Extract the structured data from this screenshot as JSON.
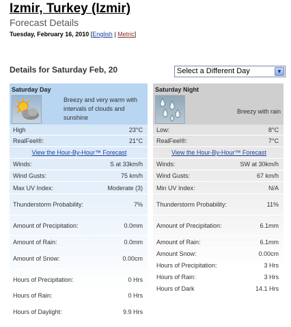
{
  "header": {
    "title": "Izmir, Turkey (Izmir)",
    "subtitle": "Forecast Details",
    "date": "Tuesday, February 16, 2010",
    "bracket_open": "[",
    "link_english": "English",
    "separator": "|",
    "link_metric": "Metric",
    "bracket_close": "]"
  },
  "details": {
    "heading": "Details for Saturday Feb, 20",
    "select_value": "Select a Different Day"
  },
  "day": {
    "title": "Saturday Day",
    "icon": "partly-sunny-icon",
    "description": "Breezy and very warm with intervals of clouds and sunshine",
    "rows": [
      {
        "label": "High",
        "value": "23°C"
      },
      {
        "label": "RealFeel®:",
        "value": "21°C"
      },
      {
        "link": "View the Hour-By-Hour™ Forecast"
      },
      {
        "label": "Winds:",
        "value": "S at 33km/h"
      },
      {
        "label": "Wind Gusts:",
        "value": "75 km/h"
      },
      {
        "label": "Max UV Index:",
        "value": "Moderate (3)"
      },
      {
        "label": "Thunderstorm Probability:",
        "value": "7%"
      },
      {
        "label": "Amount of Precipitation:",
        "value": "0.0mm"
      },
      {
        "label": "Amount of Rain:",
        "value": "0.0mm"
      },
      {
        "label": "Amount of Snow:",
        "value": "0.00cm"
      },
      {
        "label": "Hours of Precipitation:",
        "value": "0 Hrs"
      },
      {
        "label": "Hours of Rain:",
        "value": "0 Hrs"
      },
      {
        "label": "Hours of Daylight:",
        "value": "9.9 Hrs"
      }
    ]
  },
  "night": {
    "title": "Saturday Night",
    "icon": "rain-drops-icon",
    "description": "Breezy with rain",
    "rows": [
      {
        "label": "Low:",
        "value": "8°C"
      },
      {
        "label": "RealFeel®:",
        "value": "7°C"
      },
      {
        "link": "View the Hour-By-Hour™ Forecast"
      },
      {
        "label": "Winds:",
        "value": "SW at 30km/h"
      },
      {
        "label": "Wind Gusts:",
        "value": "67 km/h"
      },
      {
        "label": "Min UV Index:",
        "value": "N/A"
      },
      {
        "label": "Thunderstorm Probability:",
        "value": "11%"
      },
      {
        "label": "Amount of Precipitation:",
        "value": "6.1mm"
      },
      {
        "label": "Amount of Rain:",
        "value": "6.1mm"
      },
      {
        "label": "Amount Snow:",
        "value": "0.00cm"
      },
      {
        "label": "Hours of Precipitation:",
        "value": "3 Hrs"
      },
      {
        "label": "Hours of Rain:",
        "value": "3 Hrs"
      },
      {
        "label": "Hours of Dark",
        "value": "14.1 Hrs"
      }
    ]
  }
}
